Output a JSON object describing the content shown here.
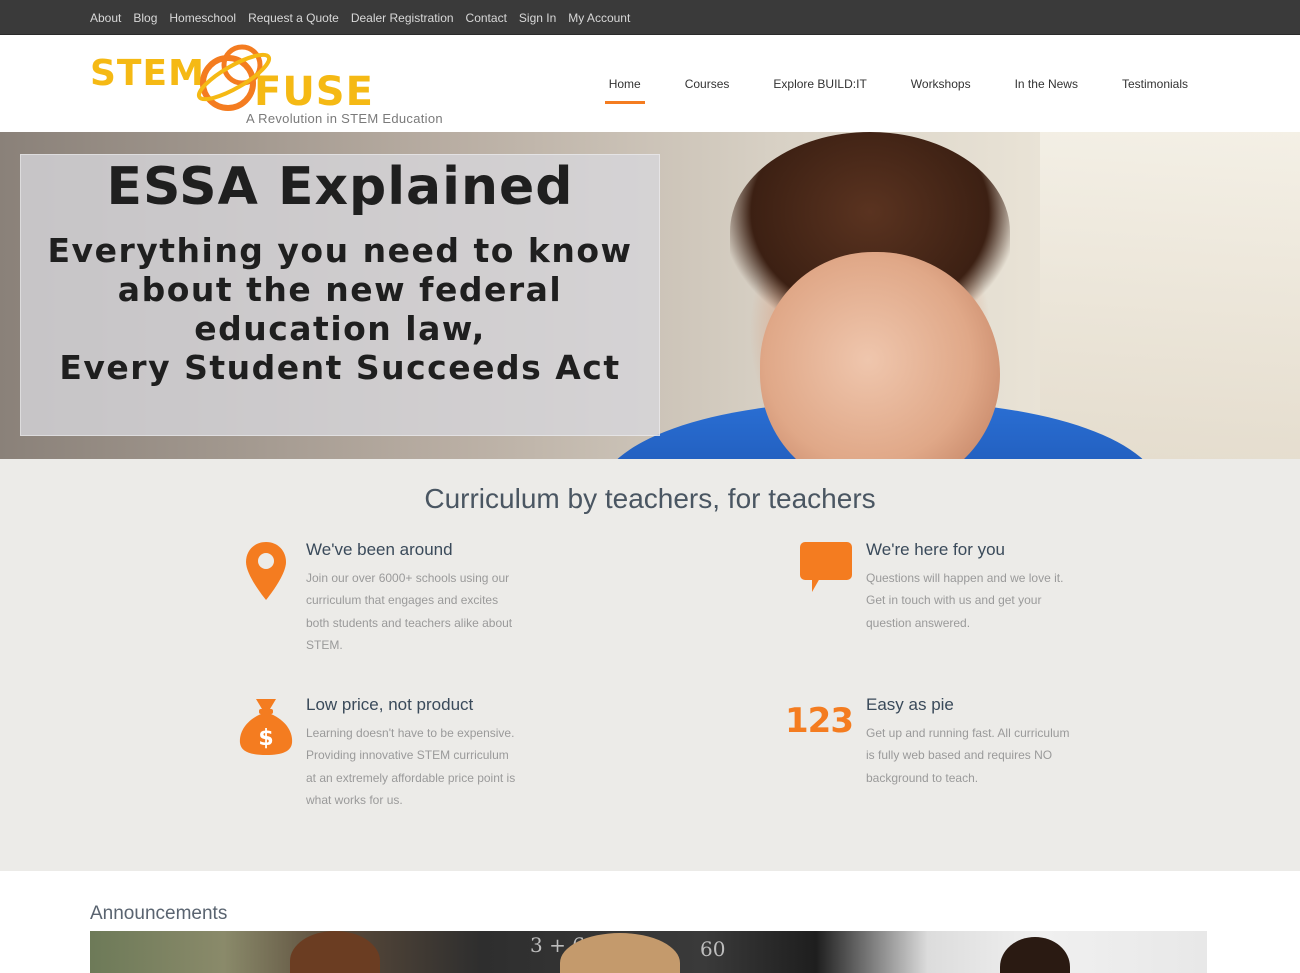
{
  "topbar": {
    "links": [
      "About",
      "Blog",
      "Homeschool",
      "Request a Quote",
      "Dealer Registration",
      "Contact",
      "Sign In",
      "My Account"
    ]
  },
  "logo": {
    "word1": "STEM",
    "word2": "FUSE",
    "tagline": "A Revolution in STEM Education"
  },
  "nav": {
    "items": [
      "Home",
      "Courses",
      "Explore BUILD:IT",
      "Workshops",
      "In the News",
      "Testimonials"
    ],
    "active": "Home"
  },
  "hero": {
    "title": "ESSA Explained",
    "subtitle_lines": [
      "Everything you need to know",
      "about the new federal",
      "education law,",
      "Every Student Succeeds Act"
    ]
  },
  "features": {
    "heading": "Curriculum by teachers, for teachers",
    "items": [
      {
        "icon": "map-pin-icon",
        "title": "We've been around",
        "body": "Join our over 6000+ schools using our curriculum that engages and excites both students and teachers alike about STEM."
      },
      {
        "icon": "speech-bubble-icon",
        "title": "We're here for you",
        "body": "Questions will happen and we love it. Get in touch with us and get your question answered."
      },
      {
        "icon": "money-bag-icon",
        "title": "Low price, not product",
        "body": "Learning doesn't have to be expensive. Providing innovative STEM curriculum at an extremely affordable price point is what works for us."
      },
      {
        "icon": "numbers-icon",
        "icon_text": "123",
        "title": "Easy as pie",
        "body": "Get up and running fast. All curriculum is fully web based and requires NO background to teach."
      }
    ]
  },
  "announcements": {
    "heading": "Announcements",
    "chalk_text": [
      "3 + 6",
      "60"
    ]
  },
  "colors": {
    "accent": "#f47c20",
    "logo_yellow": "#f5b914",
    "topbar_bg": "#3a3a3a",
    "features_bg": "#ecebe8"
  }
}
